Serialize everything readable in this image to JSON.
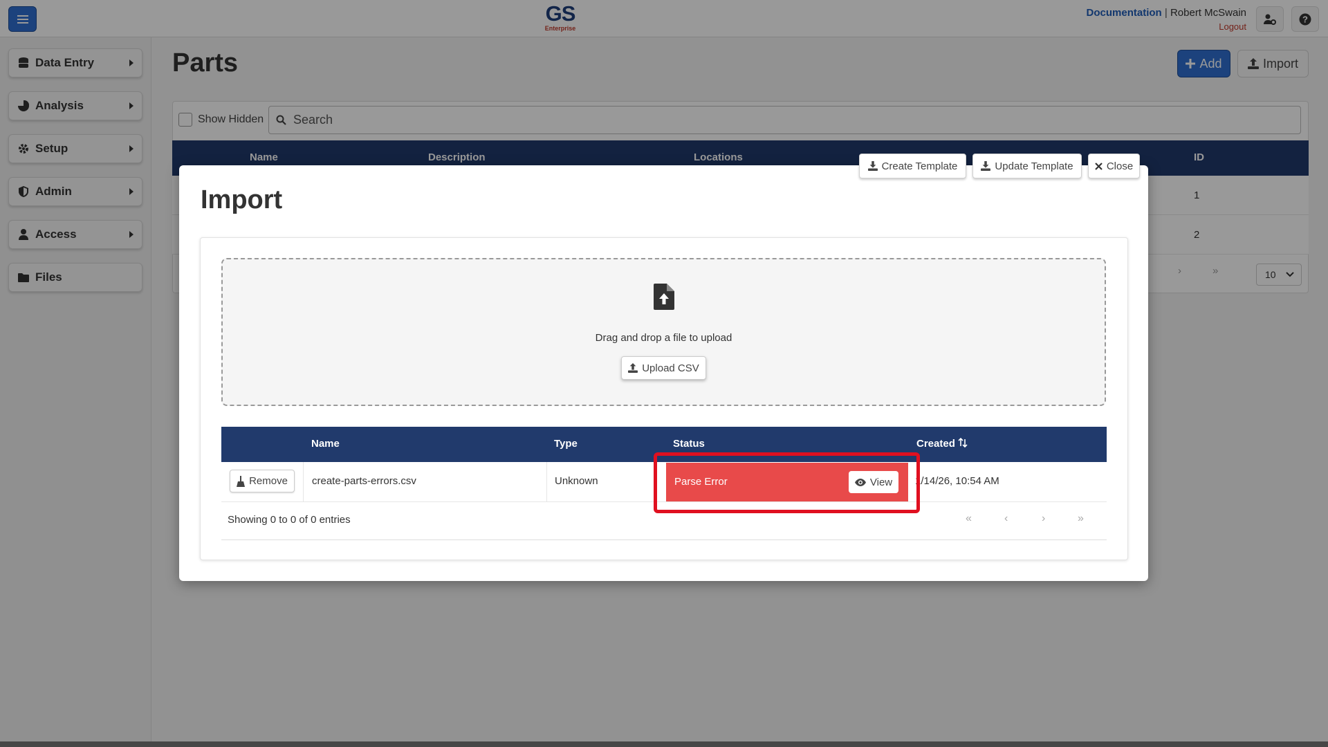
{
  "header": {
    "brand": "GS",
    "brand_sub": "Enterprise",
    "documentation": "Documentation",
    "separator": "|",
    "user": "Robert McSwain",
    "logout": "Logout"
  },
  "sidebar": {
    "items": [
      {
        "label": "Data Entry"
      },
      {
        "label": "Analysis"
      },
      {
        "label": "Setup"
      },
      {
        "label": "Admin"
      },
      {
        "label": "Access"
      },
      {
        "label": "Files"
      }
    ]
  },
  "page": {
    "title": "Parts",
    "add_label": "Add",
    "import_label": "Import",
    "show_hidden": "Show Hidden",
    "search_placeholder": "Search",
    "columns": [
      "Name",
      "Description",
      "Locations",
      "ID"
    ],
    "rows": [
      {
        "id": "1"
      },
      {
        "id": "2"
      }
    ],
    "page_size": "10"
  },
  "modal": {
    "title": "Import",
    "create_template": "Create Template",
    "update_template": "Update Template",
    "close": "Close",
    "drop_text": "Drag and drop a file to upload",
    "upload_label": "Upload CSV",
    "table": {
      "columns": [
        "Name",
        "Type",
        "Status",
        "Created"
      ],
      "rows": [
        {
          "action": "Remove",
          "name": "create-parts-errors.csv",
          "type": "Unknown",
          "status": "Parse Error",
          "view": "View",
          "created": "1/14/26, 10:54 AM"
        }
      ],
      "showing": "Showing 0 to 0 of 0 entries"
    }
  },
  "colors": {
    "primary": "#2f6fd0",
    "header_navy": "#213a6c",
    "error": "#e84a4a",
    "highlight": "#e01020"
  }
}
